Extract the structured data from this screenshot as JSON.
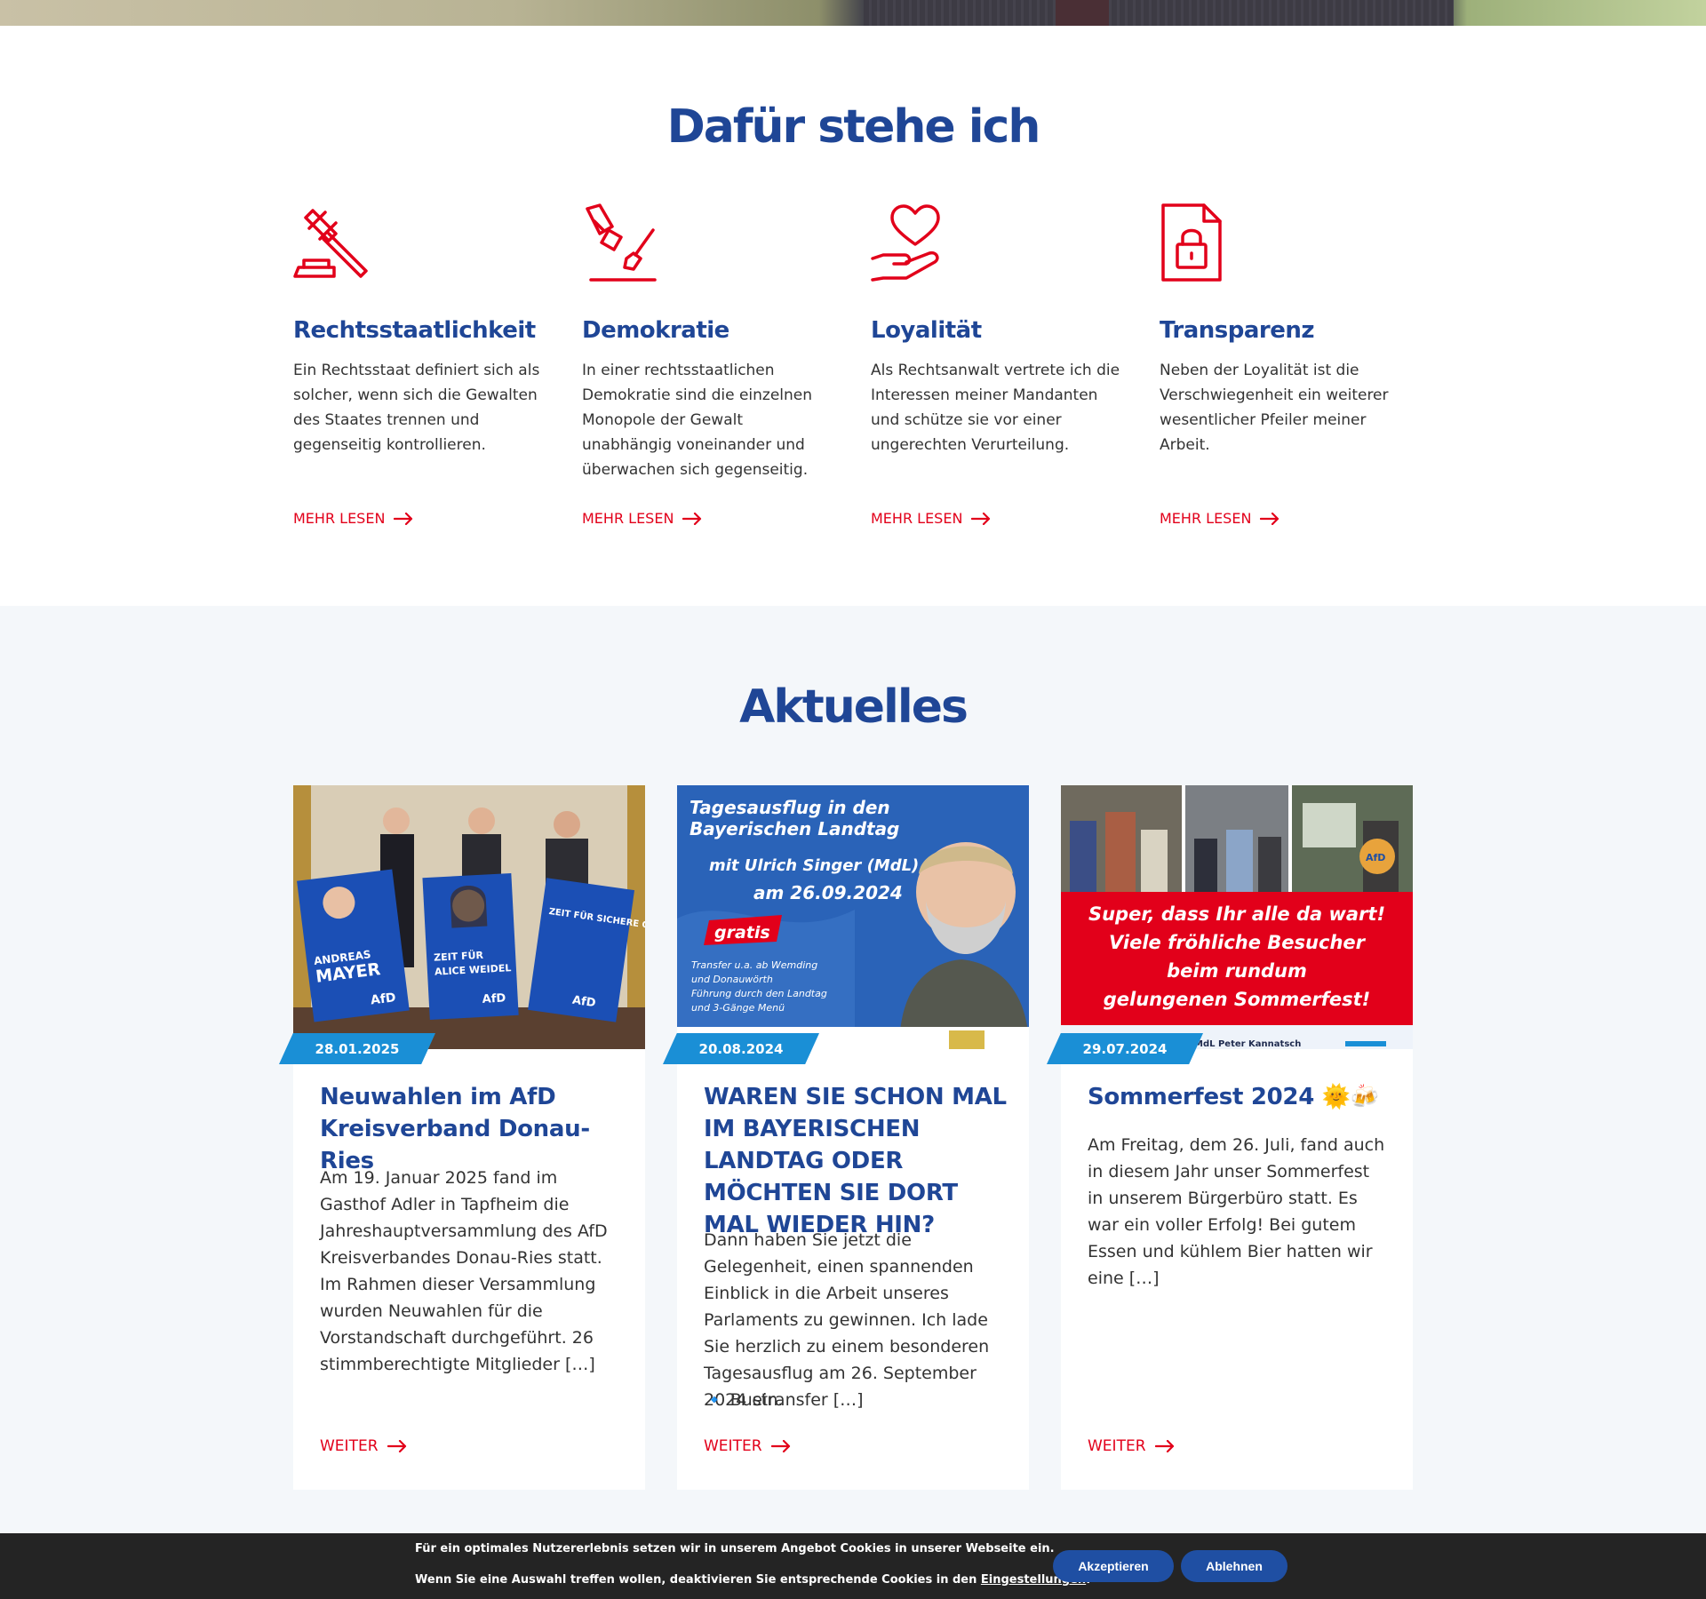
{
  "values": {
    "title": "Dafür stehe ich",
    "items": [
      {
        "icon": "gavel-icon",
        "title": "Rechtsstaatlichkeit",
        "text": "Ein Rechtsstaat definiert sich als solcher, wenn sich die Gewalten des Staates trennen und gegenseitig kontrollieren.",
        "link": "MEHR LESEN"
      },
      {
        "icon": "ballot-vote-icon",
        "title": "Demokratie",
        "text": "In einer rechtsstaatlichen Demokratie sind die einzelnen Monopole der Gewalt unabhängig voneinander und überwachen sich gegenseitig.",
        "link": "MEHR LESEN"
      },
      {
        "icon": "heart-hand-icon",
        "title": "Loyalität",
        "text": "Als Rechtsanwalt vertrete ich die Interessen meiner Mandanten und schütze sie vor einer ungerechten Verurteilung.",
        "link": "MEHR LESEN"
      },
      {
        "icon": "locked-document-icon",
        "title": "Transparenz",
        "text": "Neben der Loyalität ist die Verschwiegenheit ein weiterer wesentlicher Pfeiler meiner Arbeit.",
        "link": "MEHR LESEN"
      }
    ]
  },
  "news": {
    "title": "Aktuelles",
    "cards": [
      {
        "date": "28.01.2025",
        "title": "Neuwahlen im AfD Kreisverband Donau-Ries",
        "excerpt": "Am 19. Januar 2025 fand im Gasthof Adler in Tapfheim die Jahreshauptversammlung des AfD Kreisverbandes Donau-Ries statt. Im Rahmen dieser Versammlung wurden Neuwahlen für die Vorstandschaft durchgeführt. 26 stimmberechtigte Mitglieder […]",
        "more": "WEITER",
        "poster_1_line1": "ANDREAS",
        "poster_1_line2": "MAYER",
        "poster_2_line1": "ZEIT FÜR",
        "poster_2_line2": "ALICE WEIDEL",
        "poster_3": "ZEIT FÜR SICHERE GRENZEN.",
        "poster_logo": "AfD"
      },
      {
        "date": "20.08.2024",
        "title": "WAREN SIE SCHON MAL IM BAYERISCHEN LANDTAG ODER MÖCHTEN SIE DORT MAL WIEDER HIN?",
        "excerpt": "Dann haben Sie jetzt die Gelegenheit, einen spannenden Einblick in die Arbeit unseres Parlaments zu gewinnen. Ich lade Sie herzlich zu einem besonderen Tagesausflug am 26. September 2024 ein.",
        "excerpt_bullet": "🔹 Bustransfer […]",
        "more": "WEITER",
        "img_title_1": "Tagesausflug in den",
        "img_title_2": "Bayerischen Landtag",
        "img_sub_1": "mit Ulrich Singer (MdL)",
        "img_sub_2": "am 26.09.2024",
        "img_gratis": "gratis",
        "img_small_1": "Transfer u.a. ab Wemding",
        "img_small_2": "und Donauwörth",
        "img_small_3": "Führung durch den Landtag",
        "img_small_4": "und 3-Gänge Menü"
      },
      {
        "date": "29.07.2024",
        "title": "Sommerfest 2024 🌞🍻",
        "excerpt": "Am Freitag, dem 26. Juli, fand auch in diesem Jahr unser Sommerfest in unserem Bürgerbüro statt. Es war ein voller Erfolg! Bei gutem Essen und kühlem Bier hatten wir eine […]",
        "more": "WEITER",
        "img_line_1": "Super, dass Ihr alle da wart!",
        "img_line_2": "Viele fröhliche Besucher",
        "img_line_3": "beim rundum",
        "img_line_4": "gelungenen Sommerfest!",
        "img_footer": "MdL Peter Kannatsch",
        "img_logo": "AfD"
      }
    ]
  },
  "cookie": {
    "line1": "Für ein optimales Nutzererlebnis setzen wir in unserem Angebot Cookies in unserer Webseite ein.",
    "line2_prefix": "Wenn Sie eine Auswahl treffen wollen, deaktivieren Sie entsprechende Cookies in den ",
    "line2_link": "Eingestellungen",
    "line2_suffix": ".",
    "accept": "Akzeptieren",
    "decline": "Ablehnen"
  },
  "colors": {
    "brand_blue": "#1f4696",
    "accent_red": "#e2001a",
    "badge_blue": "#1a8fd6"
  }
}
